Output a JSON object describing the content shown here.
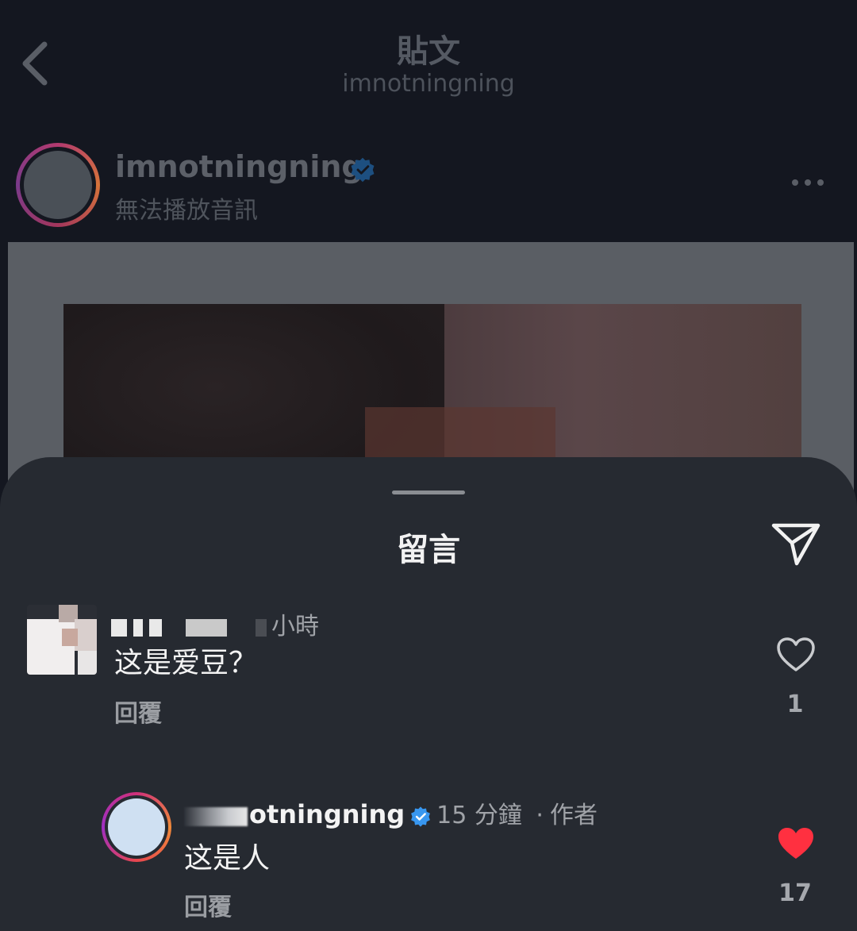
{
  "header": {
    "title": "貼文",
    "subtitle": "imnotningning"
  },
  "post": {
    "author_name": "imnotningning",
    "audio_status": "無法播放音訊"
  },
  "sheet": {
    "title": "留言"
  },
  "comments": [
    {
      "time": "小時",
      "text": "这是爱豆？",
      "reply_label": "回覆",
      "likes": "1",
      "liked": false
    },
    {
      "username_visible": "otningning",
      "time": "15 分鐘",
      "separator": "·",
      "author_tag": "作者",
      "text": "这是人",
      "reply_label": "回覆",
      "likes": "17",
      "liked": true
    }
  ],
  "colors": {
    "verified": "#3897f0",
    "like_active": "#ff3040"
  },
  "icons": {
    "back": "chevron-left-icon",
    "more": "more-horizontal-icon",
    "share": "paper-plane-icon",
    "like": "heart-icon"
  }
}
